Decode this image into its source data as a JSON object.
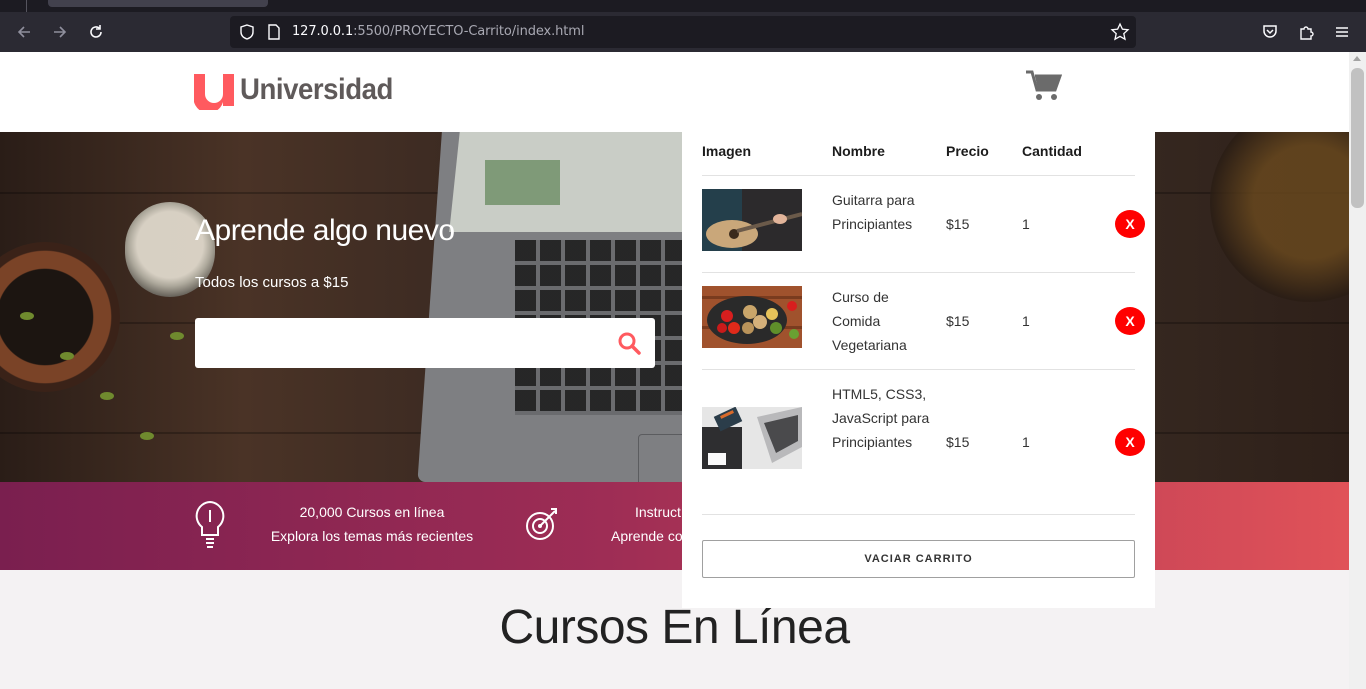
{
  "browser": {
    "url_host": "127.0.0.1",
    "url_rest": ":5500/PROYECTO-Carrito/index.html"
  },
  "header": {
    "logo_text": "Universidad",
    "brand_color": "#ff5a5f"
  },
  "hero": {
    "title": "Aprende algo nuevo",
    "subtitle": "Todos los cursos a $15",
    "search_value": ""
  },
  "features": [
    {
      "icon": "lightbulb-icon",
      "line1": "20,000 Cursos en línea",
      "line2": "Explora los temas más recientes"
    },
    {
      "icon": "target-icon",
      "line1": "Instruct",
      "line2": "Aprende co"
    }
  ],
  "main": {
    "section_title": "Cursos En Línea"
  },
  "cart": {
    "headers": {
      "image": "Imagen",
      "name": "Nombre",
      "price": "Precio",
      "quantity": "Cantidad"
    },
    "items": [
      {
        "name": "Guitarra para Principiantes",
        "price": "$15",
        "quantity": "1",
        "remove_label": "X",
        "image": "guitar-photo"
      },
      {
        "name": "Curso de Comida Vegetariana",
        "price": "$15",
        "quantity": "1",
        "remove_label": "X",
        "image": "vegetables-photo"
      },
      {
        "name": "HTML5, CSS3, JavaScript para Principiantes",
        "price": "$15",
        "quantity": "1",
        "remove_label": "X",
        "image": "laptop-desk-photo"
      }
    ],
    "empty_button": "VACIAR CARRITO",
    "remove_color": "#ff0000"
  }
}
